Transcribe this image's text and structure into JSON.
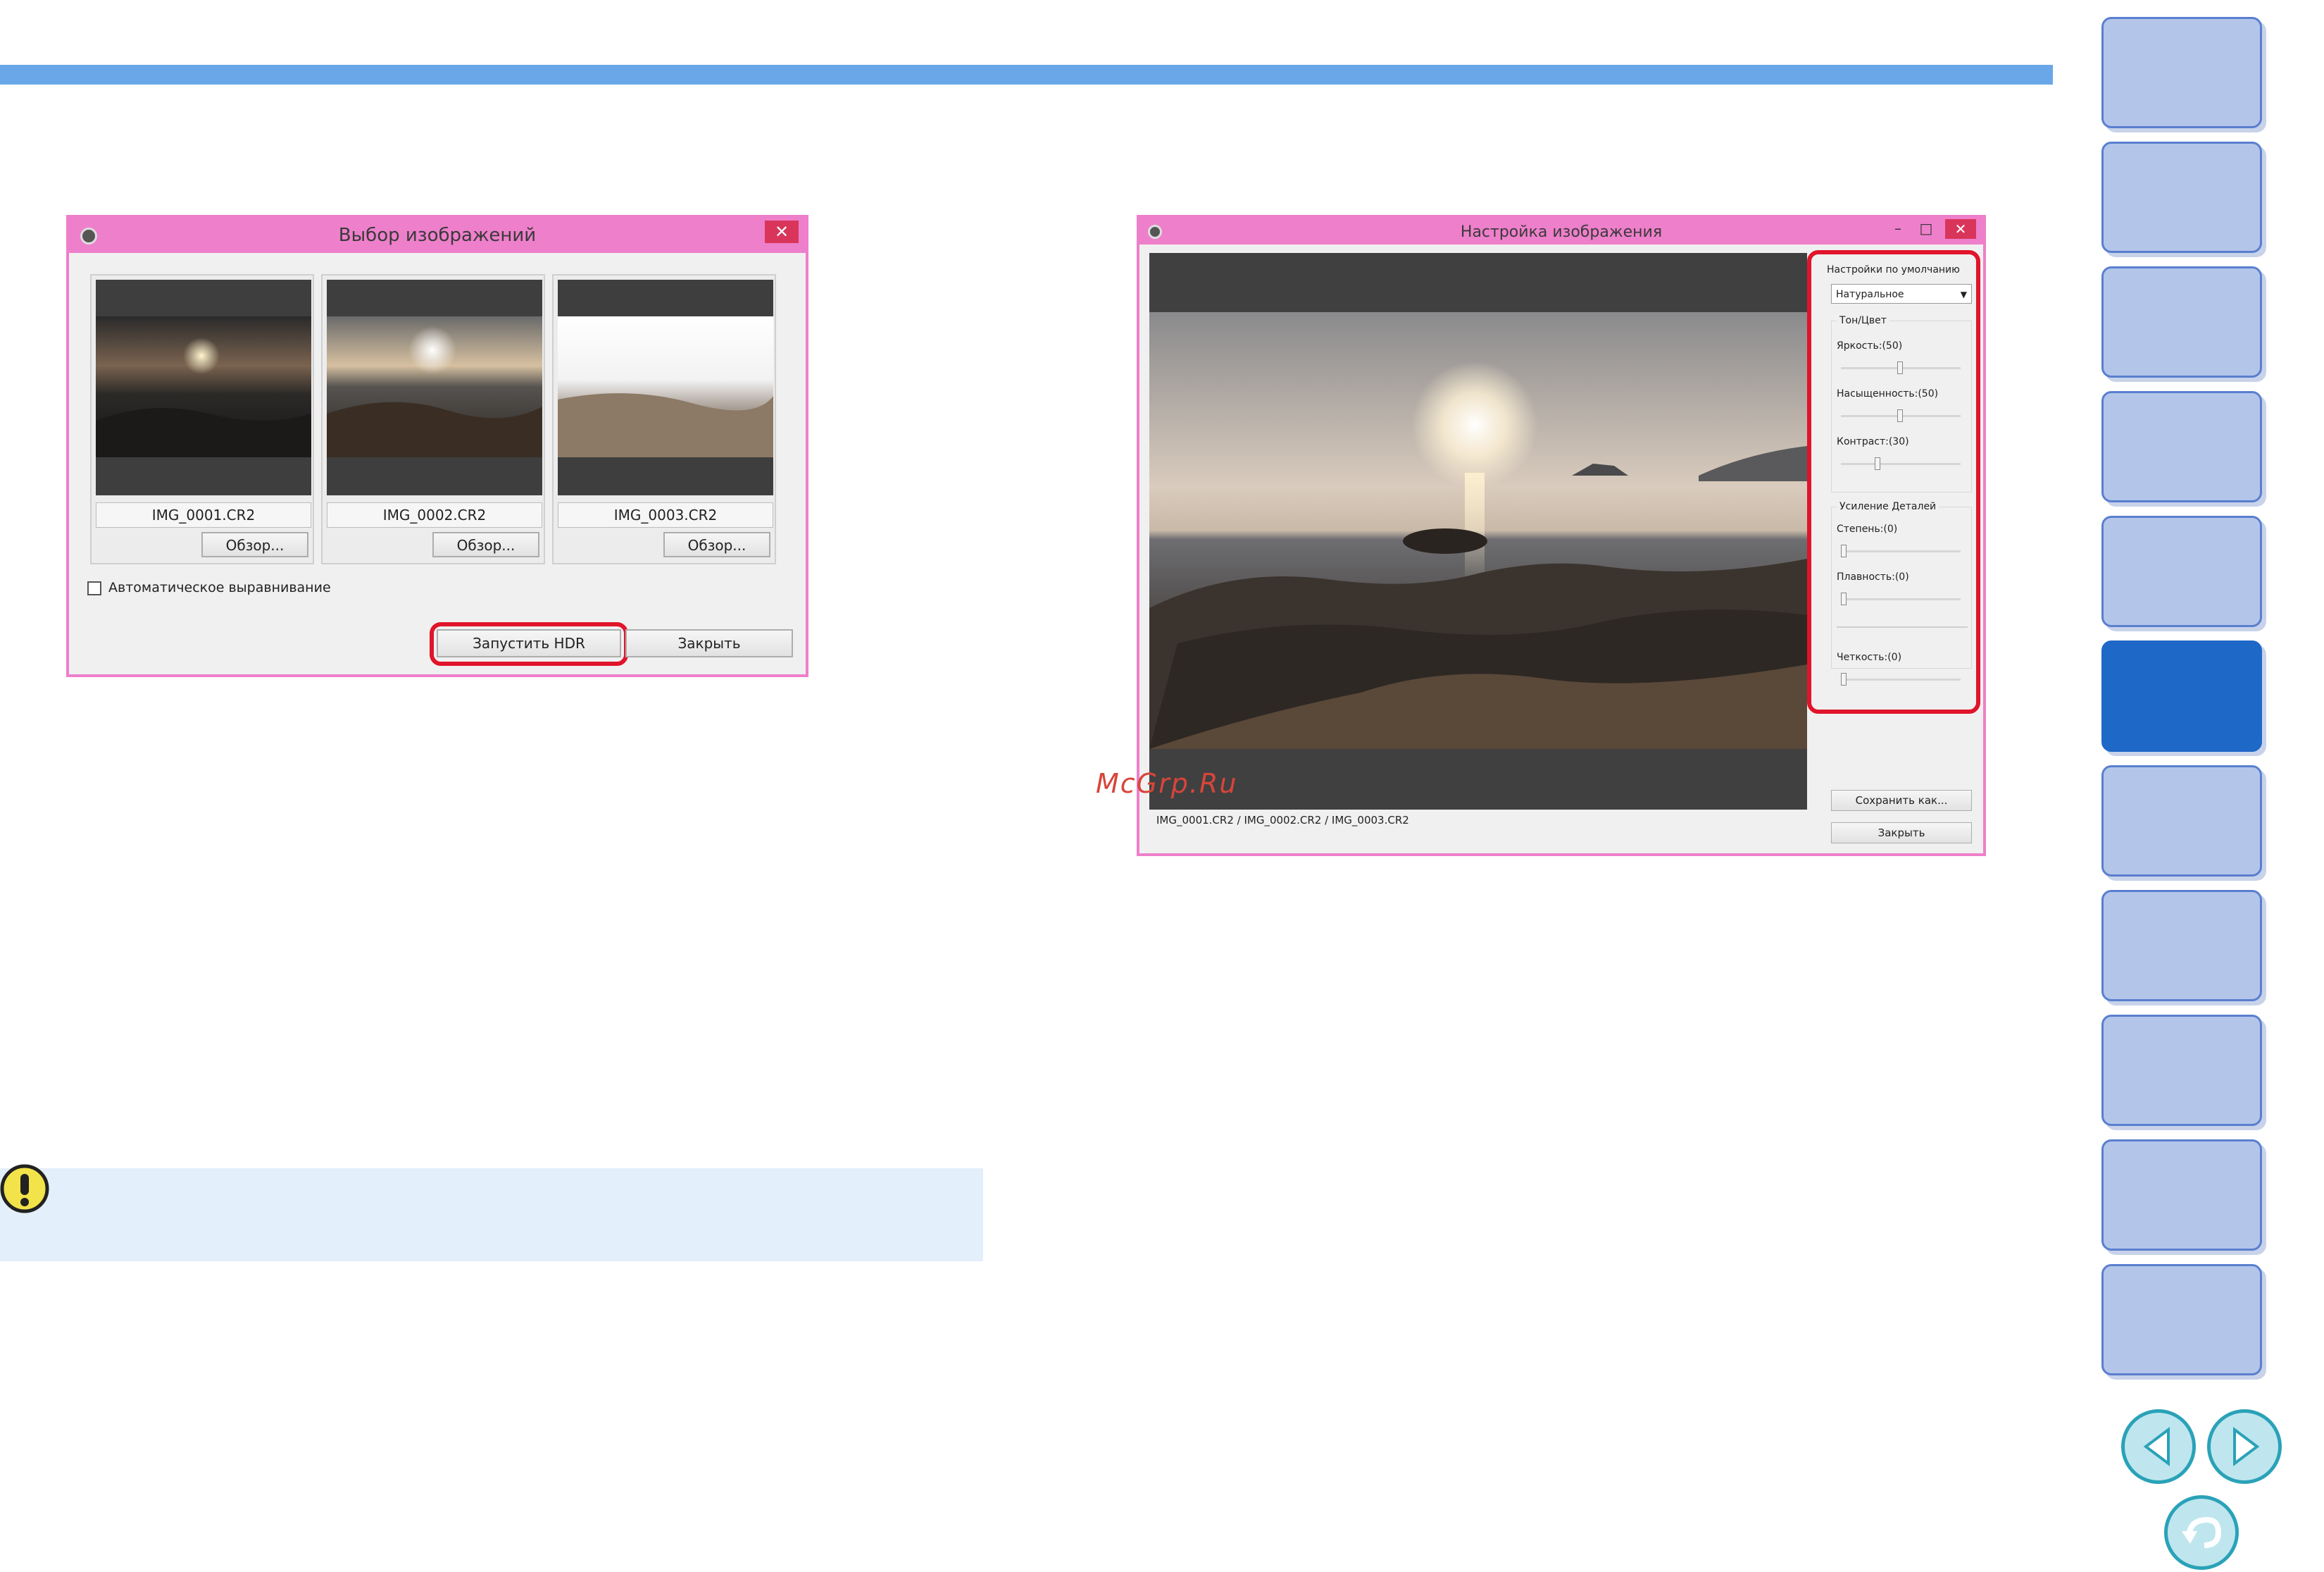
{
  "left_dialog": {
    "title": "Выбор изображений",
    "close": "✕",
    "images": [
      {
        "name": "IMG_0001.CR2",
        "browse": "Обзор..."
      },
      {
        "name": "IMG_0002.CR2",
        "browse": "Обзор..."
      },
      {
        "name": "IMG_0003.CR2",
        "browse": "Обзор..."
      }
    ],
    "auto_align_label": "Автоматическое выравнивание",
    "run_hdr_button": "Запустить HDR",
    "close_button": "Закрыть"
  },
  "right_dialog": {
    "title": "Настройка изображения",
    "minimize": "–",
    "maximize": "□",
    "close": "✕",
    "files_line": "IMG_0001.CR2 / IMG_0002.CR2 / IMG_0003.CR2",
    "defaults_label": "Настройки по умолчанию",
    "preset_value": "Натуральное",
    "tone_group": "Тон/Цвет",
    "brightness": {
      "label": "Яркость:(50)",
      "value": 50
    },
    "saturation": {
      "label": "Насыщенность:(50)",
      "value": 50
    },
    "contrast": {
      "label": "Контраст:(30)",
      "value": 30
    },
    "detail_group": "Усиление Деталей",
    "strength": {
      "label": "Степень:(0)",
      "value": 0
    },
    "smoothness": {
      "label": "Плавность:(0)",
      "value": 0
    },
    "sharpness": {
      "label": "Четкость:(0)",
      "value": 0
    },
    "save_as_button": "Сохранить как...",
    "close_button": "Закрыть"
  },
  "watermark": "McGrp.Ru",
  "colors": {
    "accent_bar": "#6aa7e8",
    "dialog_frame": "#ee7fcb",
    "highlight": "#e0142a",
    "nav_active": "#1e68c8",
    "nav_tab": "#b3c6ea"
  },
  "navigation": {
    "tab_count": 11,
    "active_tab": 6,
    "icons": [
      "prev-page-icon",
      "next-page-icon",
      "return-icon"
    ]
  },
  "warning_icon": "exclamation-icon"
}
